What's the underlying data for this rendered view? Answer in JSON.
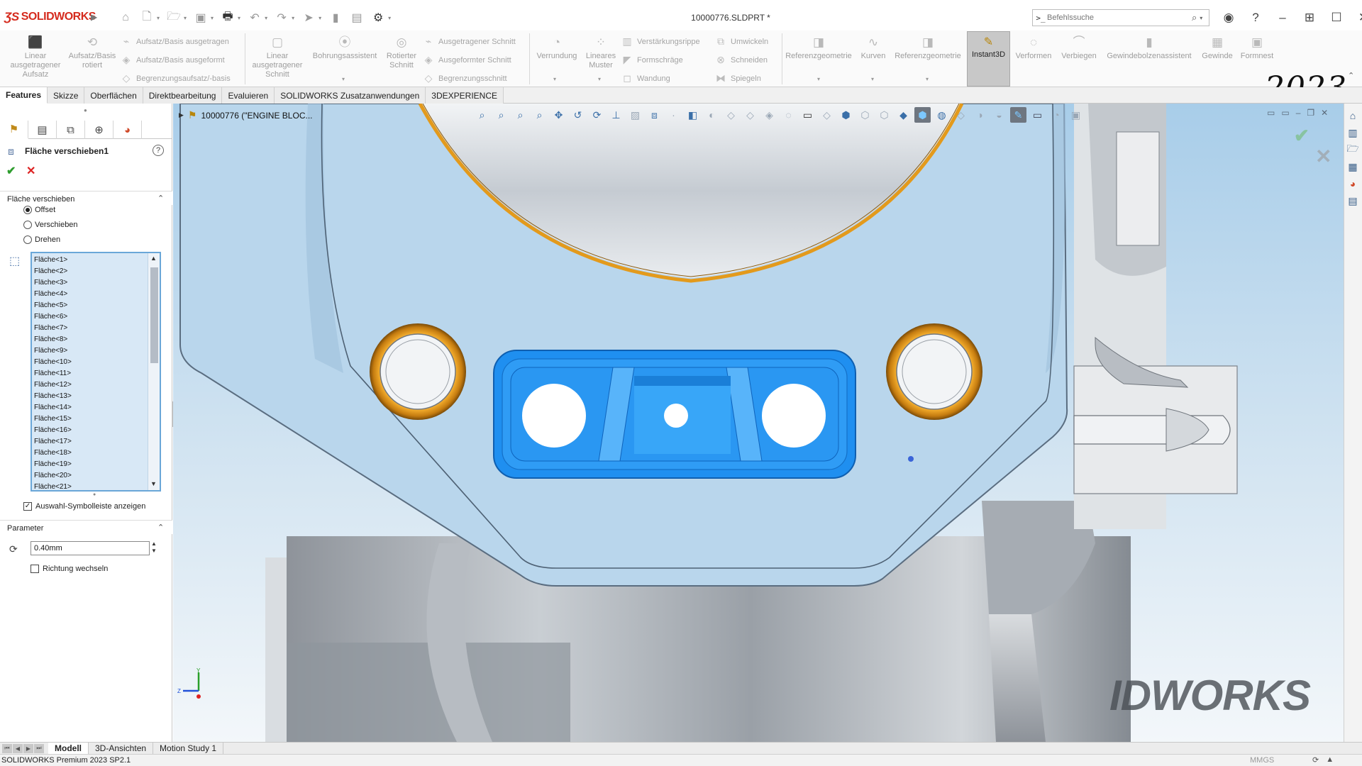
{
  "app": {
    "logo_text": "SOLIDWORKS",
    "document_title": "10000776.SLDPRT *",
    "year_badge": "2023"
  },
  "title_bar": {
    "command_search_placeholder": "Befehlssuche"
  },
  "ribbon": {
    "large_buttons": [
      {
        "label": "Linear\nausgetragener\nAufsatz",
        "icon": "extrude-boss-icon"
      },
      {
        "label": "Aufsatz/Basis\nrotiert",
        "icon": "revolve-boss-icon"
      },
      {
        "label": "Linear\nausgetragener\nSchnitt",
        "icon": "extrude-cut-icon"
      },
      {
        "label": "Bohrungsassistent",
        "icon": "hole-wizard-icon"
      },
      {
        "label": "Rotierter\nSchnitt",
        "icon": "revolve-cut-icon"
      },
      {
        "label": "Verrundung",
        "icon": "fillet-icon"
      },
      {
        "label": "Lineares\nMuster",
        "icon": "linear-pattern-icon"
      },
      {
        "label": "Referenzgeometrie",
        "icon": "reference-geometry-icon"
      },
      {
        "label": "Kurven",
        "icon": "curves-icon"
      },
      {
        "label": "Referenzgeometrie",
        "icon": "reference-geometry-icon"
      },
      {
        "label": "Verformen",
        "icon": "deform-icon"
      },
      {
        "label": "Verbiegen",
        "icon": "flex-icon"
      },
      {
        "label": "Gewindebolzenassistent",
        "icon": "stud-wizard-icon"
      },
      {
        "label": "Gewinde",
        "icon": "thread-icon"
      },
      {
        "label": "Formnest",
        "icon": "cavity-icon"
      }
    ],
    "small_buttons": [
      {
        "label": "Aufsatz/Basis ausgetragen",
        "icon": "swept-boss-icon"
      },
      {
        "label": "Aufsatz/Basis ausgeformt",
        "icon": "lofted-boss-icon"
      },
      {
        "label": "Begrenzungsaufsatz/-basis",
        "icon": "boundary-boss-icon"
      },
      {
        "label": "Ausgetragener Schnitt",
        "icon": "swept-cut-icon"
      },
      {
        "label": "Ausgeformter Schnitt",
        "icon": "lofted-cut-icon"
      },
      {
        "label": "Begrenzungsschnitt",
        "icon": "boundary-cut-icon"
      },
      {
        "label": "Verstärkungsrippe",
        "icon": "rib-icon"
      },
      {
        "label": "Formschräge",
        "icon": "draft-icon"
      },
      {
        "label": "Wandung",
        "icon": "shell-icon"
      },
      {
        "label": "Umwickeln",
        "icon": "wrap-icon"
      },
      {
        "label": "Schneiden",
        "icon": "intersect-icon"
      },
      {
        "label": "Spiegeln",
        "icon": "mirror-icon"
      }
    ],
    "instant3d_label": "Instant3D"
  },
  "tabs": [
    "Features",
    "Skizze",
    "Oberflächen",
    "Direktbearbeitung",
    "Evaluieren",
    "SOLIDWORKS Zusatzanwendungen",
    "3DEXPERIENCE"
  ],
  "property_manager": {
    "title": "Fläche verschieben1",
    "group_move_face": "Fläche verschieben",
    "radio_options": [
      {
        "label": "Offset",
        "selected": true
      },
      {
        "label": "Verschieben",
        "selected": false
      },
      {
        "label": "Drehen",
        "selected": false
      }
    ],
    "faces": [
      "Fläche<1>",
      "Fläche<2>",
      "Fläche<3>",
      "Fläche<4>",
      "Fläche<5>",
      "Fläche<6>",
      "Fläche<7>",
      "Fläche<8>",
      "Fläche<9>",
      "Fläche<10>",
      "Fläche<11>",
      "Fläche<12>",
      "Fläche<13>",
      "Fläche<14>",
      "Fläche<15>",
      "Fläche<16>",
      "Fläche<17>",
      "Fläche<18>",
      "Fläche<19>",
      "Fläche<20>",
      "Fläche<21>"
    ],
    "show_selection_toolbar": "Auswahl-Symbolleiste anzeigen",
    "group_parameter": "Parameter",
    "distance_value": "0.40mm",
    "reverse_direction": "Richtung wechseln"
  },
  "viewport": {
    "tree_flyout": "10000776 (\"ENGINE BLOC...",
    "triad_labels": {
      "y": "Y",
      "z": "Z"
    },
    "watermark": "IDWORKS",
    "colors": {
      "background_top": "#9ec6e6",
      "part_face": "#b9d6ec",
      "selected_face": "#1f8ff0",
      "edge_highlight": "#e39a1c"
    }
  },
  "bottom_tabs": [
    "Modell",
    "3D-Ansichten",
    "Motion Study 1"
  ],
  "status_bar": {
    "product": "SOLIDWORKS Premium 2023 SP2.1",
    "units": "MMGS"
  }
}
